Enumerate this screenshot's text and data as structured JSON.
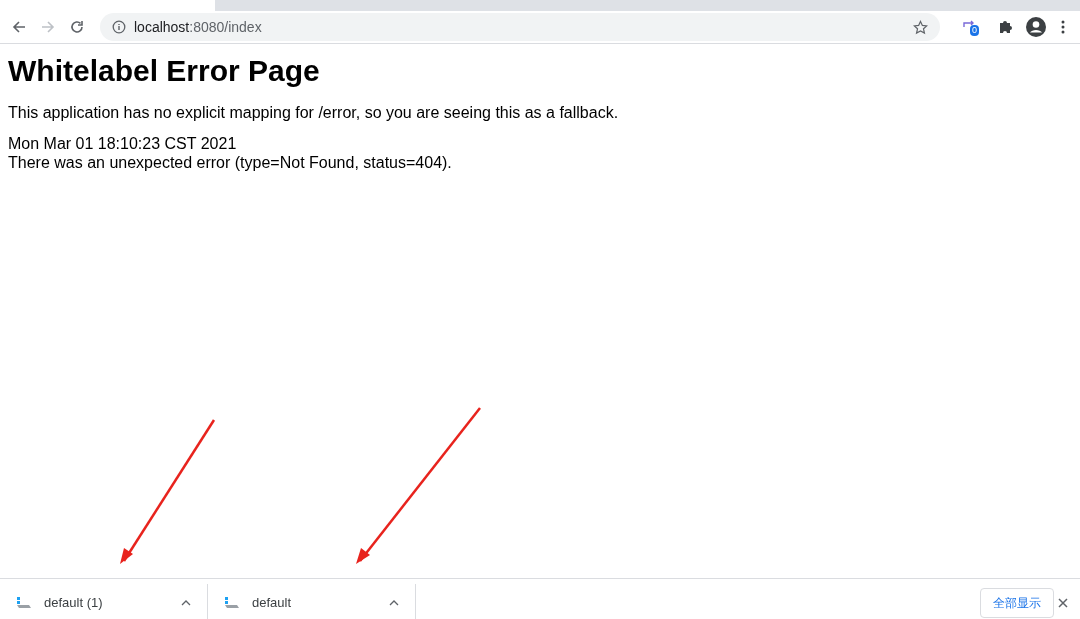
{
  "address_bar": {
    "host": "localhost",
    "path": ":8080/index"
  },
  "extension_badge": "0",
  "page": {
    "heading": "Whitelabel Error Page",
    "message": "This application has no explicit mapping for /error, so you are seeing this as a fallback.",
    "timestamp": "Mon Mar 01 18:10:23 CST 2021",
    "error": "There was an unexpected error (type=Not Found, status=404)."
  },
  "downloads": [
    {
      "name": "default (1)"
    },
    {
      "name": "default"
    }
  ],
  "show_all_button": "全部显示"
}
